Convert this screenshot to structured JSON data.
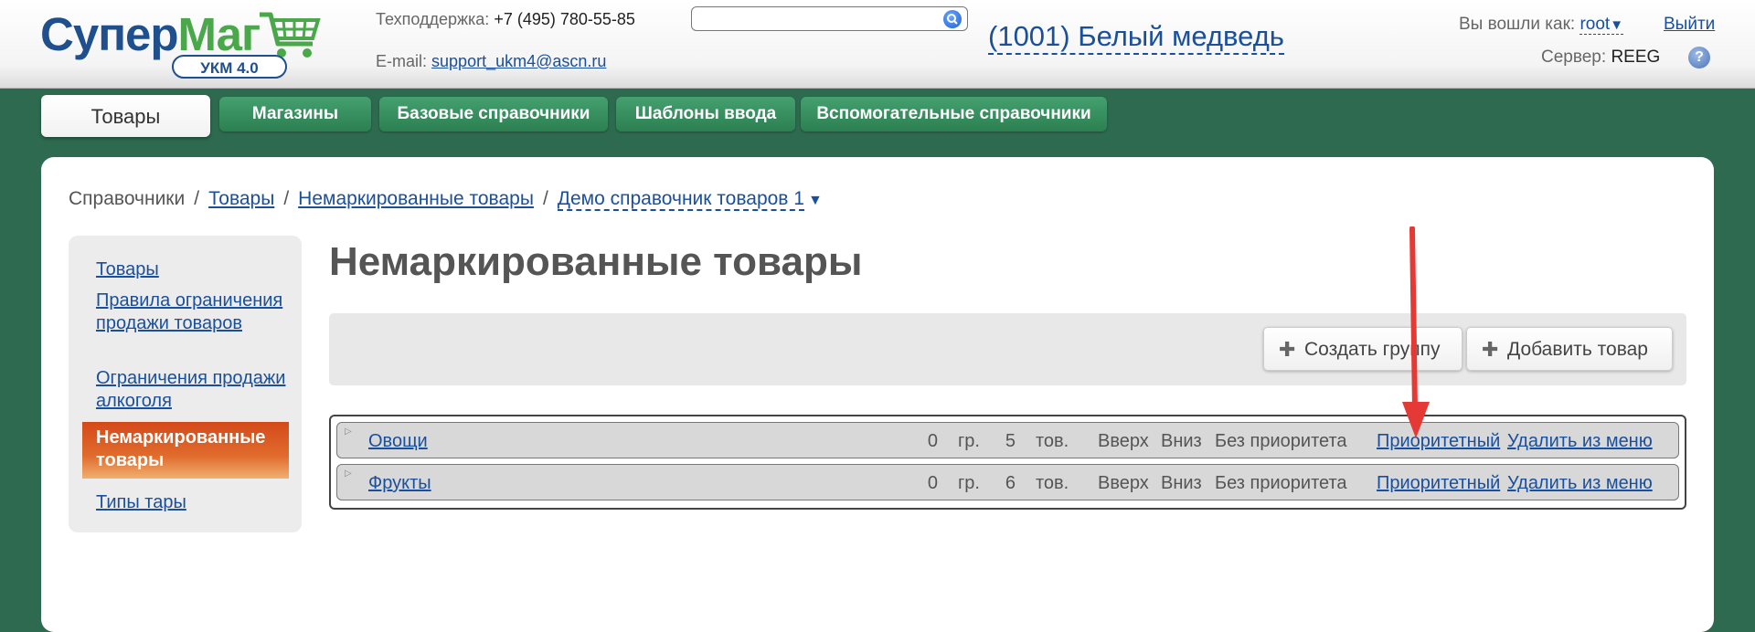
{
  "header": {
    "logo_main": "Супер",
    "logo_accent": "Маг",
    "logo_badge": "УКМ 4.0",
    "support_label": "Техподдержка:",
    "support_phone": "+7 (495) 780-55-85",
    "email_label": "E-mail:",
    "email": "support_ukm4@ascn.ru",
    "search_value": "",
    "store": "(1001) Белый медведь",
    "login_label": "Вы вошли как:",
    "login_user": "root",
    "login_arrow": "▼",
    "logout": "Выйти",
    "server_label": "Сервер:",
    "server": "REEG",
    "help": "?"
  },
  "tabs": [
    {
      "label": "Товары",
      "active": true
    },
    {
      "label": "Магазины"
    },
    {
      "label": "Базовые справочники"
    },
    {
      "label": "Шаблоны ввода"
    },
    {
      "label": "Вспомогательные справочники"
    }
  ],
  "breadcrumb": {
    "items": [
      "Справочники",
      "Товары",
      "Немаркированные товары",
      "Демо справочник товаров 1"
    ],
    "separator": "/",
    "arrow": "▼"
  },
  "sidebar": {
    "items": [
      "Товары",
      "Правила ограничения продажи товаров",
      "Ограничения продажи алкоголя",
      "Немаркированные товары",
      "Типы тары"
    ]
  },
  "page_title": "Немаркированные товары",
  "toolbar": {
    "create_group": "Создать группу",
    "add_product": "Добавить товар",
    "plus": "✚"
  },
  "groups": {
    "unit_groups": "гр.",
    "unit_products": "тов.",
    "up": "Вверх",
    "down": "Вниз",
    "no_priority": "Без приоритета",
    "priority": "Приоритетный",
    "remove": "Удалить из меню",
    "expander": "▷",
    "rows": [
      {
        "name": "Овощи",
        "groups": "0",
        "products": "5"
      },
      {
        "name": "Фрукты",
        "groups": "0",
        "products": "6"
      }
    ]
  },
  "colors": {
    "background": "#2d6a4f",
    "tab": "#3a9262",
    "link": "#1a4f9c",
    "active_sidebar": "#d44a1a",
    "arrow": "#e53935"
  }
}
